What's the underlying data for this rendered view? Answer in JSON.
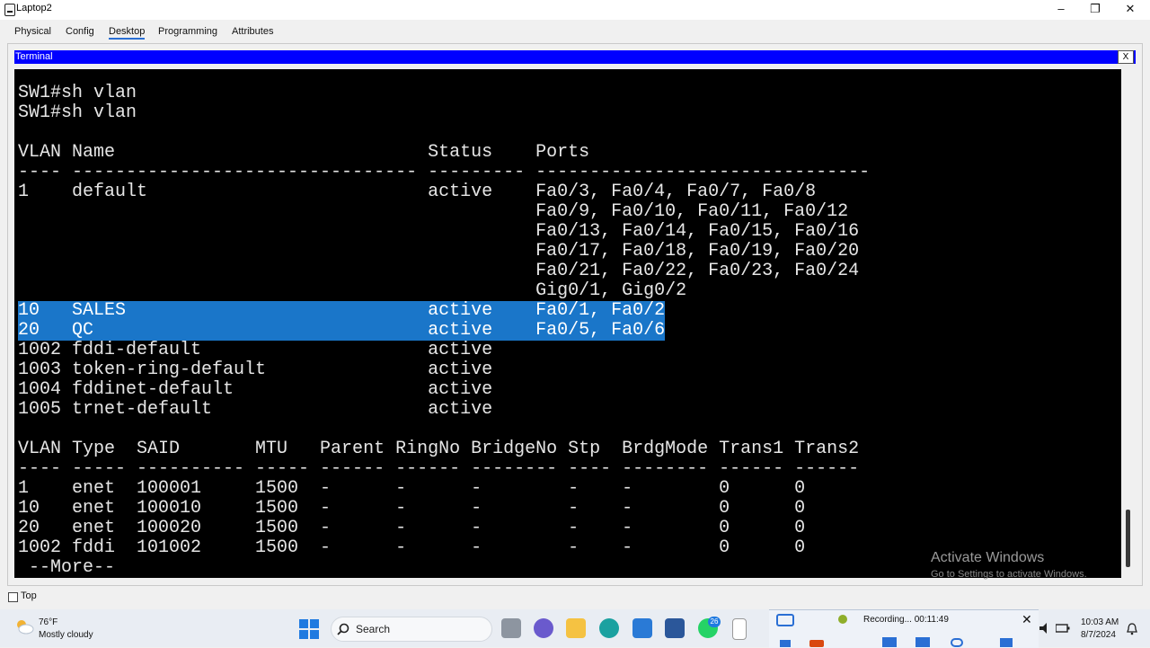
{
  "window": {
    "title": "Laptop2"
  },
  "tabs": [
    "Physical",
    "Config",
    "Desktop",
    "Programming",
    "Attributes"
  ],
  "terminal": {
    "title": "Terminal",
    "close_label": "X",
    "lines": [
      "",
      "SW1#sh vlan",
      "SW1#sh vlan",
      "",
      "VLAN Name                             Status    Ports",
      "---- -------------------------------- --------- -------------------------------",
      "1    default                          active    Fa0/3, Fa0/4, Fa0/7, Fa0/8",
      "                                                Fa0/9, Fa0/10, Fa0/11, Fa0/12",
      "                                                Fa0/13, Fa0/14, Fa0/15, Fa0/16",
      "                                                Fa0/17, Fa0/18, Fa0/19, Fa0/20",
      "                                                Fa0/21, Fa0/22, Fa0/23, Fa0/24",
      "                                                Gig0/1, Gig0/2",
      "10   SALES                            active    Fa0/1, Fa0/2",
      "20   QC                               active    Fa0/5, Fa0/6",
      "1002 fddi-default                     active",
      "1003 token-ring-default               active",
      "1004 fddinet-default                  active",
      "1005 trnet-default                    active",
      "",
      "VLAN Type  SAID       MTU   Parent RingNo BridgeNo Stp  BrdgMode Trans1 Trans2",
      "---- ----- ---------- ----- ------ ------ -------- ---- -------- ------ ------",
      "1    enet  100001     1500  -      -      -        -    -        0      0",
      "10   enet  100010     1500  -      -      -        -    -        0      0",
      "20   enet  100020     1500  -      -      -        -    -        0      0",
      "1002 fddi  101002     1500  -      -      -        -    -        0      0",
      " --More--"
    ]
  },
  "watermark": {
    "line1": "Activate Windows",
    "line2": "Go to Settings to activate Windows."
  },
  "footer": {
    "top_label": "Top"
  },
  "taskbar": {
    "weather_temp": "76°F",
    "weather_desc": "Mostly cloudy",
    "search_label": "Search",
    "badge_count": "26",
    "recording": "Recording... 00:11:49",
    "time": "10:03 AM",
    "date": "8/7/2024"
  },
  "colors": {
    "selection": "#1a76c9",
    "terminal_title_bar": "#0000ff",
    "terminal_bg": "#000000"
  }
}
